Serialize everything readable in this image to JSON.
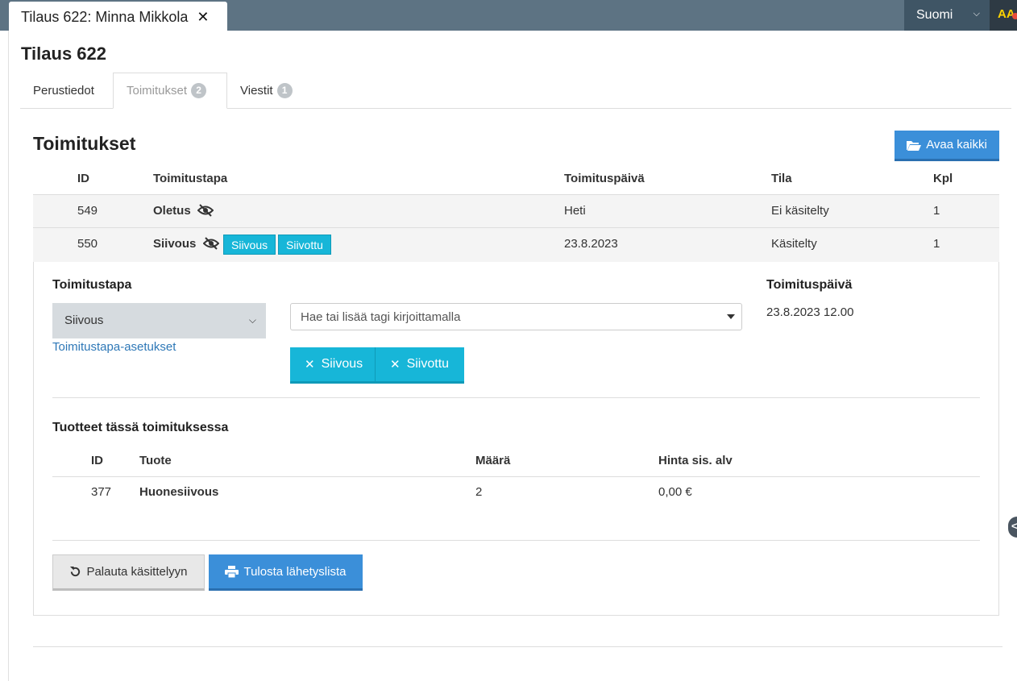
{
  "window_tab": {
    "title": "Tilaus 622: Minna Mikkola",
    "close_glyph": "✕"
  },
  "topbar": {
    "language": "Suomi",
    "aa_label": "AA",
    "accent": "#5d7383"
  },
  "page": {
    "title": "Tilaus 622"
  },
  "tabs": [
    {
      "label": "Perustiedot",
      "badge": ""
    },
    {
      "label": "Toimitukset",
      "badge": "2"
    },
    {
      "label": "Viestit",
      "badge": "1"
    }
  ],
  "deliveries": {
    "title": "Toimitukset",
    "open_all_label": "Avaa kaikki",
    "columns": [
      "ID",
      "Toimitustapa",
      "Toimituspäivä",
      "Tila",
      "Kpl"
    ],
    "rows": [
      {
        "id": "549",
        "method": "Oletus",
        "tags": [],
        "date": "Heti",
        "status": "Ei käsitelty",
        "qty": "1"
      },
      {
        "id": "550",
        "method": "Siivous",
        "tags": [
          "Siivous",
          "Siivottu"
        ],
        "date": "23.8.2023",
        "status": "Käsitelty",
        "qty": "1"
      }
    ]
  },
  "detail": {
    "method_label": "Toimitustapa",
    "method_value": "Siivous",
    "method_settings_link": "Toimitustapa-asetukset",
    "tag_placeholder": "Hae tai lisää tagi kirjoittamalla",
    "tags": [
      "Siivous",
      "Siivottu"
    ],
    "date_label": "Toimituspäivä",
    "date_value": "23.8.2023 12.00",
    "products_title": "Tuotteet tässä toimituksessa",
    "product_columns": [
      "ID",
      "Tuote",
      "Määrä",
      "Hinta sis. alv"
    ],
    "products": [
      {
        "id": "377",
        "name": "Huonesiivous",
        "qty": "2",
        "price": "0,00 €"
      }
    ],
    "restore_label": "Palauta käsittelyyn",
    "print_label": "Tulosta lähetyslista"
  },
  "colors": {
    "primary": "#3b8fd9",
    "tag": "#17b6d8",
    "link": "#2e78b7"
  }
}
